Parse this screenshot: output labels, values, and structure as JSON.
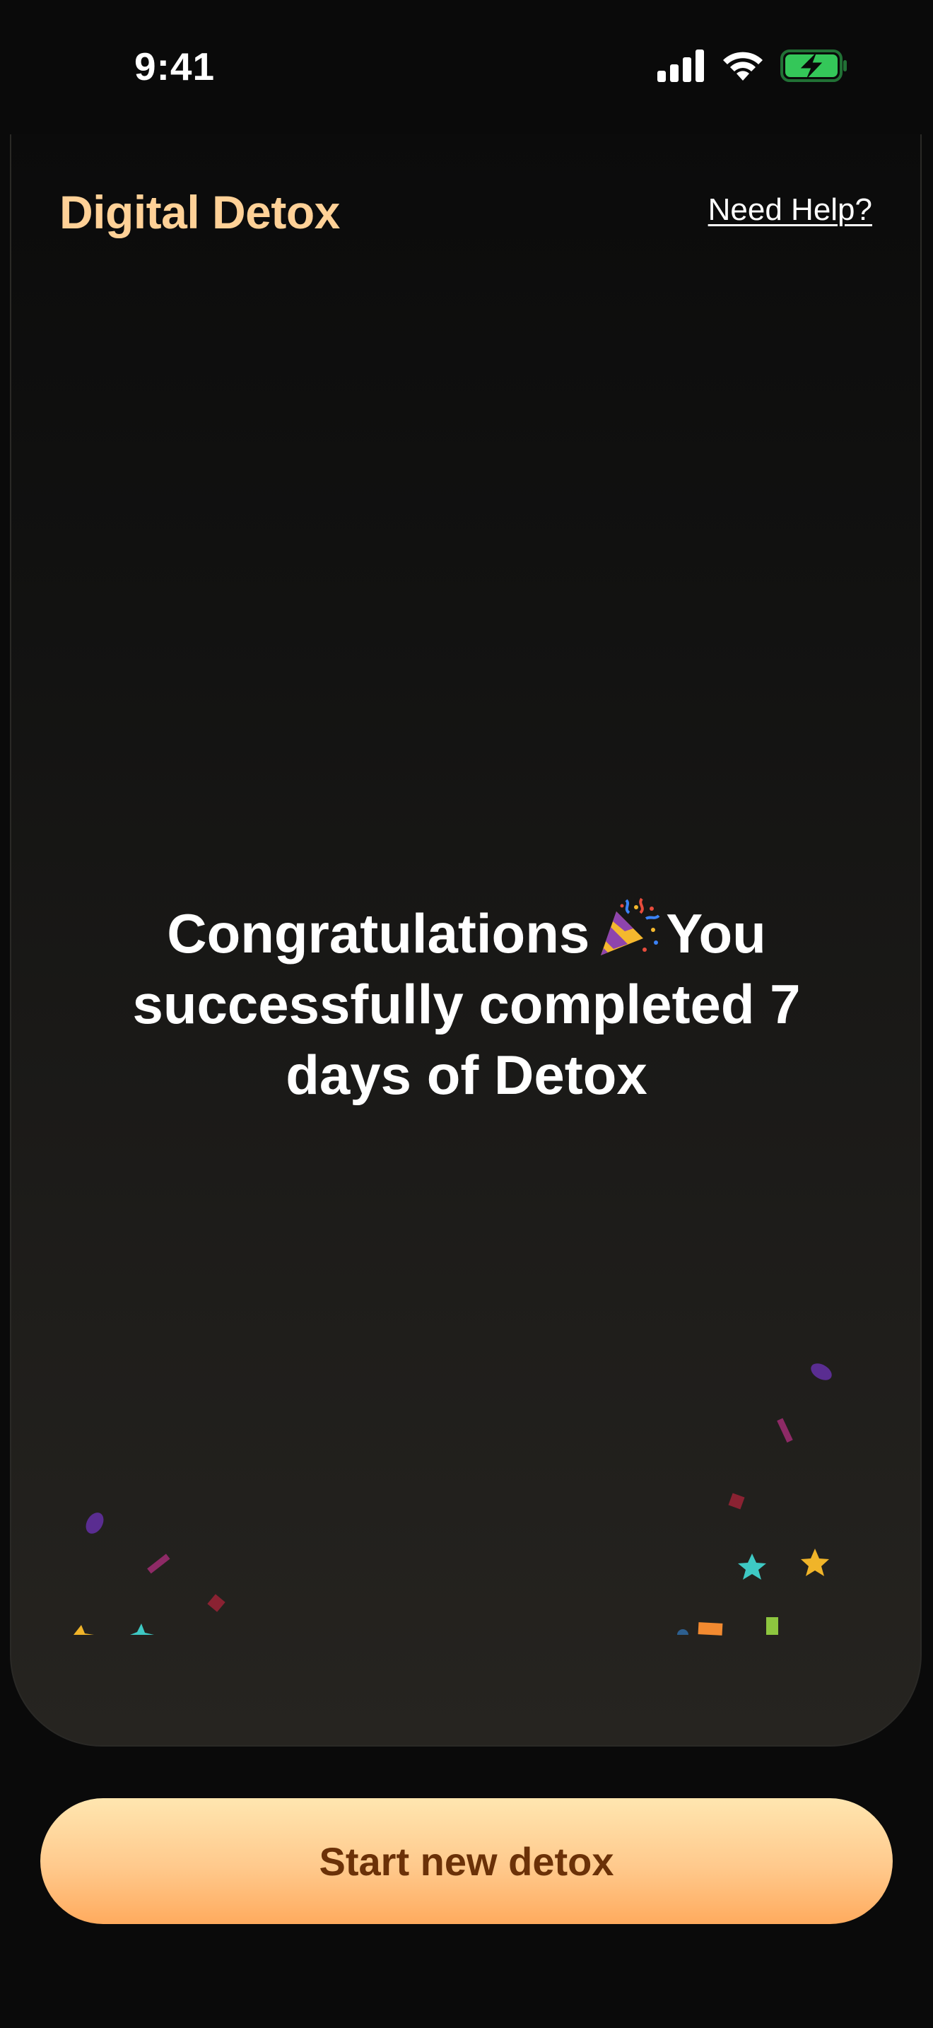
{
  "status_bar": {
    "time": "9:41",
    "icons": [
      "cellular-signal-icon",
      "wifi-icon",
      "battery-charging-icon"
    ]
  },
  "header": {
    "title": "Digital Detox",
    "help_link": "Need Help?"
  },
  "message": {
    "part1": "Congratulations",
    "emoji": "party-popper-icon",
    "part2": "You successfully completed 7 days of Detox"
  },
  "cta": {
    "label": "Start new detox"
  },
  "colors": {
    "accent": "#ffd197",
    "button_text": "#6b3108",
    "background": "#0a0a0a",
    "battery_green": "#34c759"
  }
}
